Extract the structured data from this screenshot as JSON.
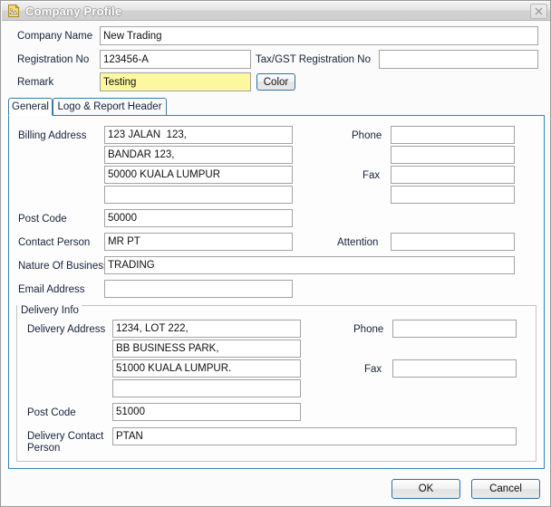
{
  "window": {
    "title": "Company Profile",
    "icon": "document-image-icon",
    "close_label": "×"
  },
  "header_form": {
    "company_name": {
      "label": "Company Name",
      "value": "New Trading"
    },
    "registration_no": {
      "label": "Registration No",
      "value": "123456-A"
    },
    "tax_gst_no": {
      "label": "Tax/GST Registration No",
      "value": ""
    },
    "remark": {
      "label": "Remark",
      "value": "Testing",
      "highlight_color": "#fbf8a0"
    },
    "color_button": {
      "label": "Color"
    }
  },
  "tabs": [
    {
      "label": "General",
      "active": true
    },
    {
      "label": "Logo & Report Header",
      "active": false
    }
  ],
  "general": {
    "billing_address": {
      "label": "Billing Address",
      "lines": [
        "123 JALAN  123,",
        "BANDAR 123,",
        "50000 KUALA LUMPUR",
        ""
      ]
    },
    "phone": {
      "label": "Phone",
      "value": "",
      "value2": ""
    },
    "fax": {
      "label": "Fax",
      "value": "",
      "value2": ""
    },
    "post_code": {
      "label": "Post Code",
      "value": "50000"
    },
    "contact_person": {
      "label": "Contact Person",
      "value": "MR PT"
    },
    "attention": {
      "label": "Attention",
      "value": ""
    },
    "nature_of_business": {
      "label": "Nature Of Business",
      "value": "TRADING"
    },
    "email_address": {
      "label": "Email Address",
      "value": ""
    }
  },
  "delivery_info": {
    "group_title": "Delivery Info",
    "delivery_address": {
      "label": "Delivery Address",
      "lines": [
        "1234, LOT 222,",
        "BB BUSINESS PARK,",
        "51000 KUALA LUMPUR.",
        ""
      ]
    },
    "phone": {
      "label": "Phone",
      "value": ""
    },
    "fax": {
      "label": "Fax",
      "value": ""
    },
    "post_code": {
      "label": "Post Code",
      "value": "51000"
    },
    "delivery_contact_person": {
      "label": "Delivery Contact Person",
      "value": "PTAN"
    }
  },
  "footer": {
    "ok_label": "OK",
    "cancel_label": "Cancel"
  },
  "colors": {
    "accent_border": "#2e86b8",
    "tab_border": "#3a7ca8",
    "field_border": "#a3a3a3",
    "label_text": "#16213a",
    "window_bg": "#fbfbfb",
    "highlight_yellow": "#fbf8a0"
  }
}
